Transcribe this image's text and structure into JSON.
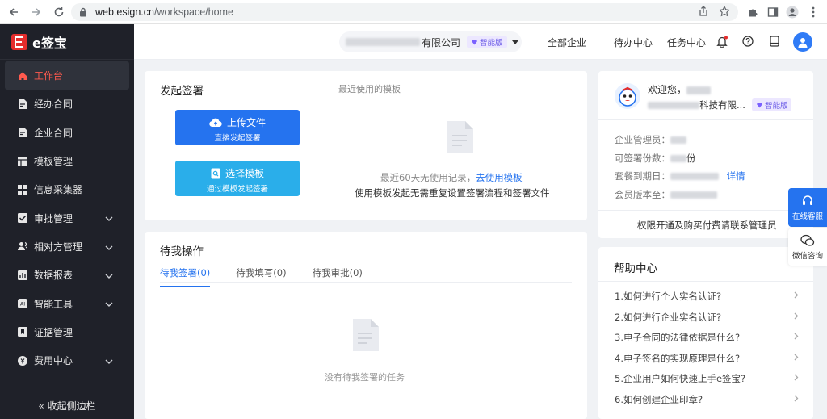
{
  "browser": {
    "url_domain": "web.esign.cn",
    "url_path": "/workspace/home"
  },
  "sidebar": {
    "logo_text": "e签宝",
    "items": [
      {
        "label": "工作台",
        "icon": "home-icon",
        "active": true
      },
      {
        "label": "经办合同",
        "icon": "document-icon"
      },
      {
        "label": "企业合同",
        "icon": "document-icon"
      },
      {
        "label": "模板管理",
        "icon": "template-icon"
      },
      {
        "label": "信息采集器",
        "icon": "grid-icon"
      },
      {
        "label": "审批管理",
        "icon": "checkbox-icon",
        "expandable": true
      },
      {
        "label": "相对方管理",
        "icon": "users-icon",
        "expandable": true
      },
      {
        "label": "数据报表",
        "icon": "chart-icon",
        "expandable": true
      },
      {
        "label": "智能工具",
        "icon": "ai-icon",
        "expandable": true
      },
      {
        "label": "证据管理",
        "icon": "bookmark-icon"
      },
      {
        "label": "费用中心",
        "icon": "coin-icon",
        "expandable": true
      }
    ],
    "collapse_label": "« 收起侧边栏"
  },
  "header": {
    "company_suffix": "有限公司",
    "plan_badge": "智能版",
    "links": [
      "全部企业",
      "待办中心",
      "任务中心"
    ]
  },
  "sign_card": {
    "title": "发起签署",
    "recent_label": "最近使用的模板",
    "upload_main": "上传文件",
    "upload_sub": "直接发起签署",
    "template_main": "选择模板",
    "template_sub": "通过模板发起签署",
    "empty_text": "最近60天无使用记录，",
    "empty_link": "去使用模板",
    "hint": "使用模板发起无需重复设置签署流程和签署文件"
  },
  "todo_card": {
    "title": "待我操作",
    "tabs": [
      "待我签署(0)",
      "待我填写(0)",
      "待我审批(0)"
    ],
    "empty_text": "没有待我签署的任务"
  },
  "welcome_card": {
    "greeting": "欢迎您，",
    "company_suffix": "科技有限...",
    "plan_badge": "智能版",
    "rows": [
      {
        "label": "企业管理员："
      },
      {
        "label": "可签署份数：",
        "suffix": "份"
      },
      {
        "label": "套餐到期日：",
        "link": "详情"
      },
      {
        "label": "会员版本至："
      }
    ],
    "footer": "权限开通及购买付费请联系管理员"
  },
  "help_card": {
    "title": "帮助中心",
    "items": [
      "1.如何进行个人实名认证?",
      "2.如何进行企业实名认证?",
      "3.电子合同的法律依据是什么?",
      "4.电子签名的实现原理是什么?",
      "5.企业用户如何快速上手e签宝?",
      "6.如何创建企业印章?"
    ]
  },
  "floating": {
    "online_service": "在线客服",
    "wechat": "微信咨询"
  },
  "colors": {
    "brand_red": "#e52d2d",
    "primary_blue": "#2573ef",
    "sidebar_bg": "#1f2129"
  }
}
